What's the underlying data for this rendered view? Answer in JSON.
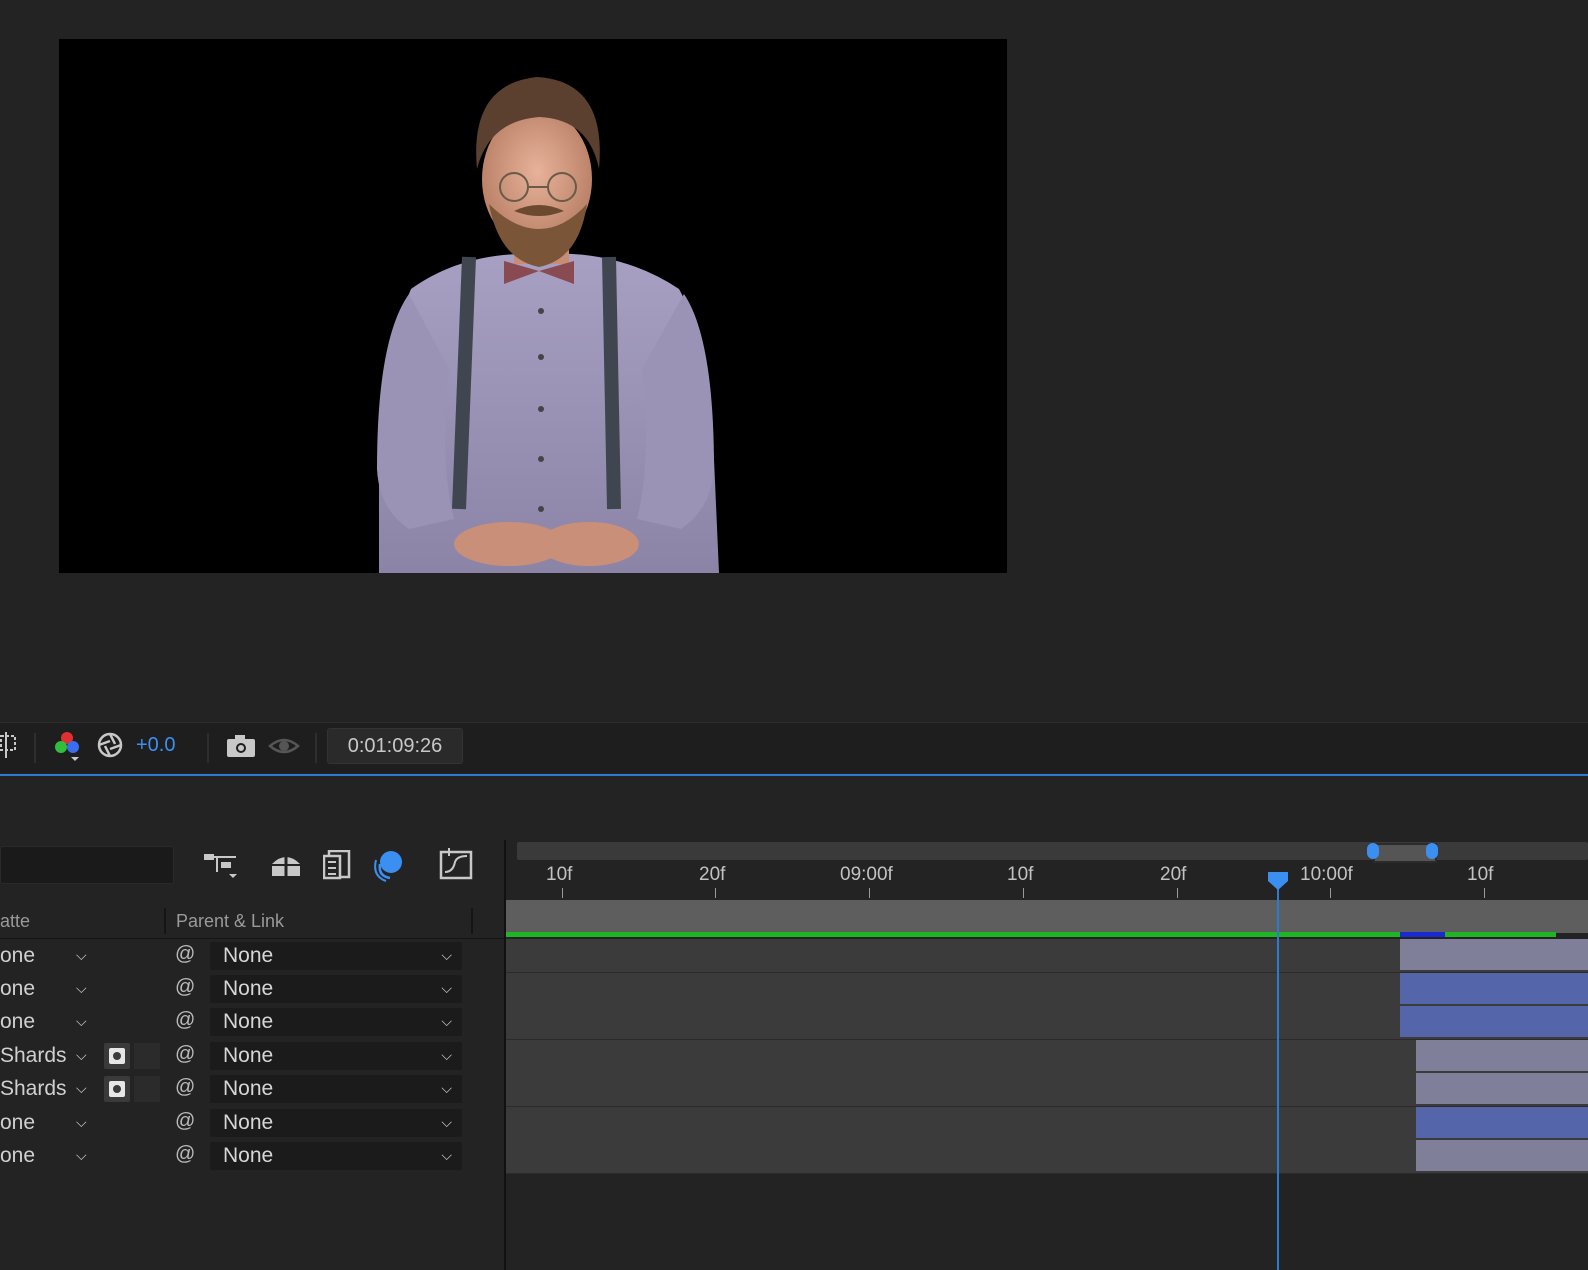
{
  "viewer": {
    "exposure_value": "+0.0",
    "timecode": "0:01:09:26",
    "preview_description": ""
  },
  "timeline": {
    "columns": {
      "track_matte": "atte",
      "parent_link": "Parent & Link"
    },
    "ruler_labels": [
      "10f",
      "20f",
      "09:00f",
      "10f",
      "20f",
      "10:00f",
      "10f"
    ],
    "layers": [
      {
        "track_matte": "one",
        "parent": "None",
        "has_matte_icon": false,
        "bar": "gray"
      },
      {
        "track_matte": "one",
        "parent": "None",
        "has_matte_icon": false,
        "bar": "blue"
      },
      {
        "track_matte": "one",
        "parent": "None",
        "has_matte_icon": false,
        "bar": "blue"
      },
      {
        "track_matte": "Shards",
        "parent": "None",
        "has_matte_icon": true,
        "bar": "gray"
      },
      {
        "track_matte": "Shards",
        "parent": "None",
        "has_matte_icon": true,
        "bar": "gray"
      },
      {
        "track_matte": "one",
        "parent": "None",
        "has_matte_icon": false,
        "bar": "blue"
      },
      {
        "track_matte": "one",
        "parent": "None",
        "has_matte_icon": false,
        "bar": "gray"
      }
    ]
  },
  "icons": {
    "region_of_interest": "region-of-interest-icon",
    "channels": "rgb-channels-icon",
    "exposure": "exposure-aperture-icon",
    "snapshot": "camera-snapshot-icon",
    "show_snapshot": "show-snapshot-icon",
    "composition_flowchart": "composition-flowchart-icon",
    "draft_3d": "draft-3d-icon",
    "frame_blending": "frame-blending-icon",
    "motion_blur": "motion-blur-icon",
    "graph_editor": "graph-editor-icon"
  },
  "colors": {
    "accent_blue": "#2f7ad1",
    "render_green": "#1fb626",
    "layer_gray": "#7f7f9a",
    "layer_blue": "#5565a9"
  }
}
